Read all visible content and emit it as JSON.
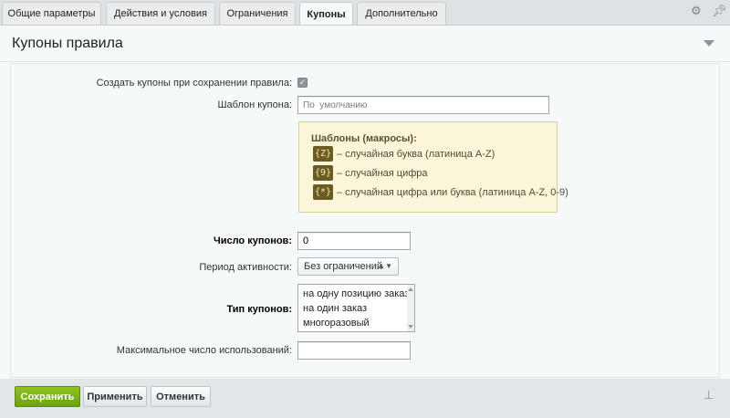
{
  "tabs": [
    {
      "label": "Общие параметры"
    },
    {
      "label": "Действия и условия"
    },
    {
      "label": "Ограничения"
    },
    {
      "label": "Купоны"
    },
    {
      "label": "Дополнительно"
    }
  ],
  "active_tab": "Купоны",
  "header_icons": {
    "settings": "gear-icon",
    "pin": "pin-icon"
  },
  "section": {
    "title": "Купоны правила",
    "collapse_icon": "chevron-down-icon"
  },
  "form": {
    "create_coupons": {
      "label": "Создать купоны при сохранении правила:",
      "checked": true
    },
    "template": {
      "label": "Шаблон купона:",
      "placeholder": "По  умолчанию"
    },
    "hint": {
      "title": "Шаблоны (макросы):",
      "items": [
        {
          "macro": "{Z}",
          "text": "– случайная буква (латиница A-Z)"
        },
        {
          "macro": "{9}",
          "text": "– случайная цифра"
        },
        {
          "macro": "{*}",
          "text": "– случайная цифра или буква (латиница A-Z, 0-9)"
        }
      ]
    },
    "count": {
      "label": "Число купонов:",
      "value": "0"
    },
    "period": {
      "label": "Период активности:",
      "selected": "Без ограничений"
    },
    "coupon_type": {
      "label": "Тип купонов:",
      "options": [
        "на одну позицию заказа",
        "на один заказ",
        "многоразовый"
      ]
    },
    "max_uses": {
      "label": "Максимальное число использований:",
      "value": ""
    }
  },
  "footer": {
    "save": "Сохранить",
    "apply": "Применить",
    "cancel": "Отменить"
  },
  "colors": {
    "accent_green": "#7ab317",
    "hint_bg": "#fbf6d9",
    "macro_badge": "#6b5d22",
    "page_bg": "#e1e6e8"
  }
}
